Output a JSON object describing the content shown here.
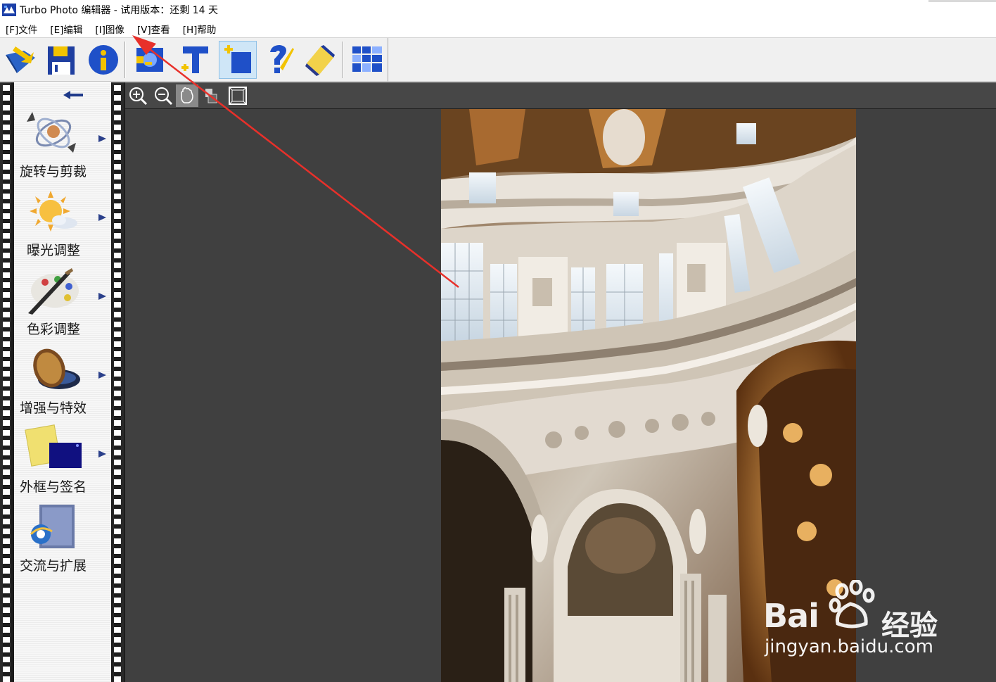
{
  "window": {
    "title": "Turbo Photo 编辑器  - 试用版本：还剩 14 天"
  },
  "menu": {
    "items": [
      {
        "label": "[F]文件"
      },
      {
        "label": "[E]编辑"
      },
      {
        "label": "[I]图像"
      },
      {
        "label": "[V]查看"
      },
      {
        "label": "[H]帮助"
      }
    ]
  },
  "toolbar": {
    "buttons": [
      {
        "icon": "open-folder-icon"
      },
      {
        "icon": "save-icon"
      },
      {
        "icon": "info-icon"
      },
      {
        "icon": "add-image-icon"
      },
      {
        "icon": "add-text-icon"
      },
      {
        "icon": "add-frame-icon",
        "selected": true
      },
      {
        "icon": "help-icon"
      },
      {
        "icon": "pencil-eraser-icon"
      },
      {
        "icon": "grid-view-icon"
      }
    ]
  },
  "sidepanel": {
    "back_icon": "back-arrow-icon",
    "tools": [
      {
        "label": "旋转与剪裁",
        "icon": "rotate-crop-icon"
      },
      {
        "label": "曝光调整",
        "icon": "exposure-sun-icon"
      },
      {
        "label": "色彩调整",
        "icon": "color-palette-icon"
      },
      {
        "label": "增强与特效",
        "icon": "lens-filter-icon"
      },
      {
        "label": "外框与签名",
        "icon": "frame-sign-icon"
      },
      {
        "label": "交流与扩展",
        "icon": "internet-explorer-icon"
      }
    ]
  },
  "view_toolbar": {
    "buttons": [
      {
        "icon": "zoom-in-icon"
      },
      {
        "icon": "zoom-out-icon"
      },
      {
        "icon": "hand-pan-icon",
        "active": true
      },
      {
        "icon": "actual-size-icon"
      },
      {
        "icon": "fit-window-icon"
      }
    ]
  },
  "watermark": {
    "brand": "Bai",
    "brand_cn": "经验",
    "url": "jingyan.baidu.com"
  },
  "colors": {
    "workspace_bg": "#404040",
    "annotation_red": "#e8302a",
    "selected_btn": "#cfe6f7"
  }
}
